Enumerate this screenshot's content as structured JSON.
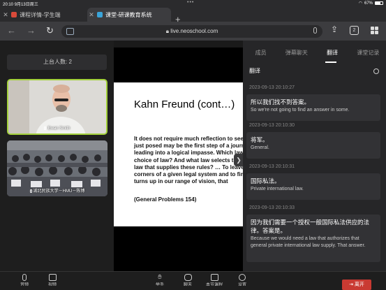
{
  "status_bar": {
    "time": "20:10",
    "date": "9月13日周三",
    "battery": "67%",
    "battery_level": 0.67
  },
  "browser": {
    "tabs": [
      {
        "title": "课程详情-学生端",
        "active": false
      },
      {
        "title": "课堂-研课教育系统",
        "active": true
      }
    ],
    "url": "live.neoschool.com",
    "tab_count": "2"
  },
  "sidebar": {
    "count_label": "上台人数: 2",
    "videos": [
      {
        "name": "Ewan Smith"
      },
      {
        "name": "湖北民族大学－HMU－陈博"
      }
    ]
  },
  "slide": {
    "title": "Kahn Freund (cont…)",
    "body_lines": [
      "It does not require much reflection to see that the question",
      "just posed may be the first step of a journey",
      "leading into a logical impasse. Which law governs the",
      "choice of law? And what law selects the",
      "law that supplies these rules? … To leave the",
      "corners of a given legal system and to find the law which",
      "turns up in our range of vision, that"
    ],
    "reference": "(General Problems 154)"
  },
  "panel": {
    "tabs": [
      "成员",
      "弹幕聊天",
      "翻译",
      "课堂记录"
    ],
    "active_tab": 2,
    "title": "翻译",
    "entries": [
      {
        "time": "2023-09-13 20:10:27",
        "zh": "所以我们找不到答案。",
        "en": "So we're not going to find an answer in some."
      },
      {
        "time": "2023-09-13 20:10:30",
        "zh": "将军。",
        "en": "General."
      },
      {
        "time": "2023-09-13 20:10:31",
        "zh": "国际私法。",
        "en": "Private international law."
      },
      {
        "time": "2023-09-13 20:10:33",
        "zh": "因为我们需要一个授权一般国际私法供应的法律。答案是。",
        "en": "Because we would need a law that authorizes that general private international law supply. That answer."
      }
    ]
  },
  "toolbar": {
    "buttons": [
      {
        "label": "音频",
        "icon": "microphone-icon"
      },
      {
        "label": "视频",
        "icon": "camera-icon"
      },
      {
        "label": "举手",
        "icon": "hand-raise-icon"
      },
      {
        "label": "聊天",
        "icon": "chat-icon"
      },
      {
        "label": "本节课程",
        "icon": "course-icon"
      },
      {
        "label": "设置",
        "icon": "settings-icon"
      }
    ],
    "leave_label": "离开"
  },
  "colors": {
    "active_speaker_border": "#a3d13b",
    "leave_button": "#c93a32"
  }
}
